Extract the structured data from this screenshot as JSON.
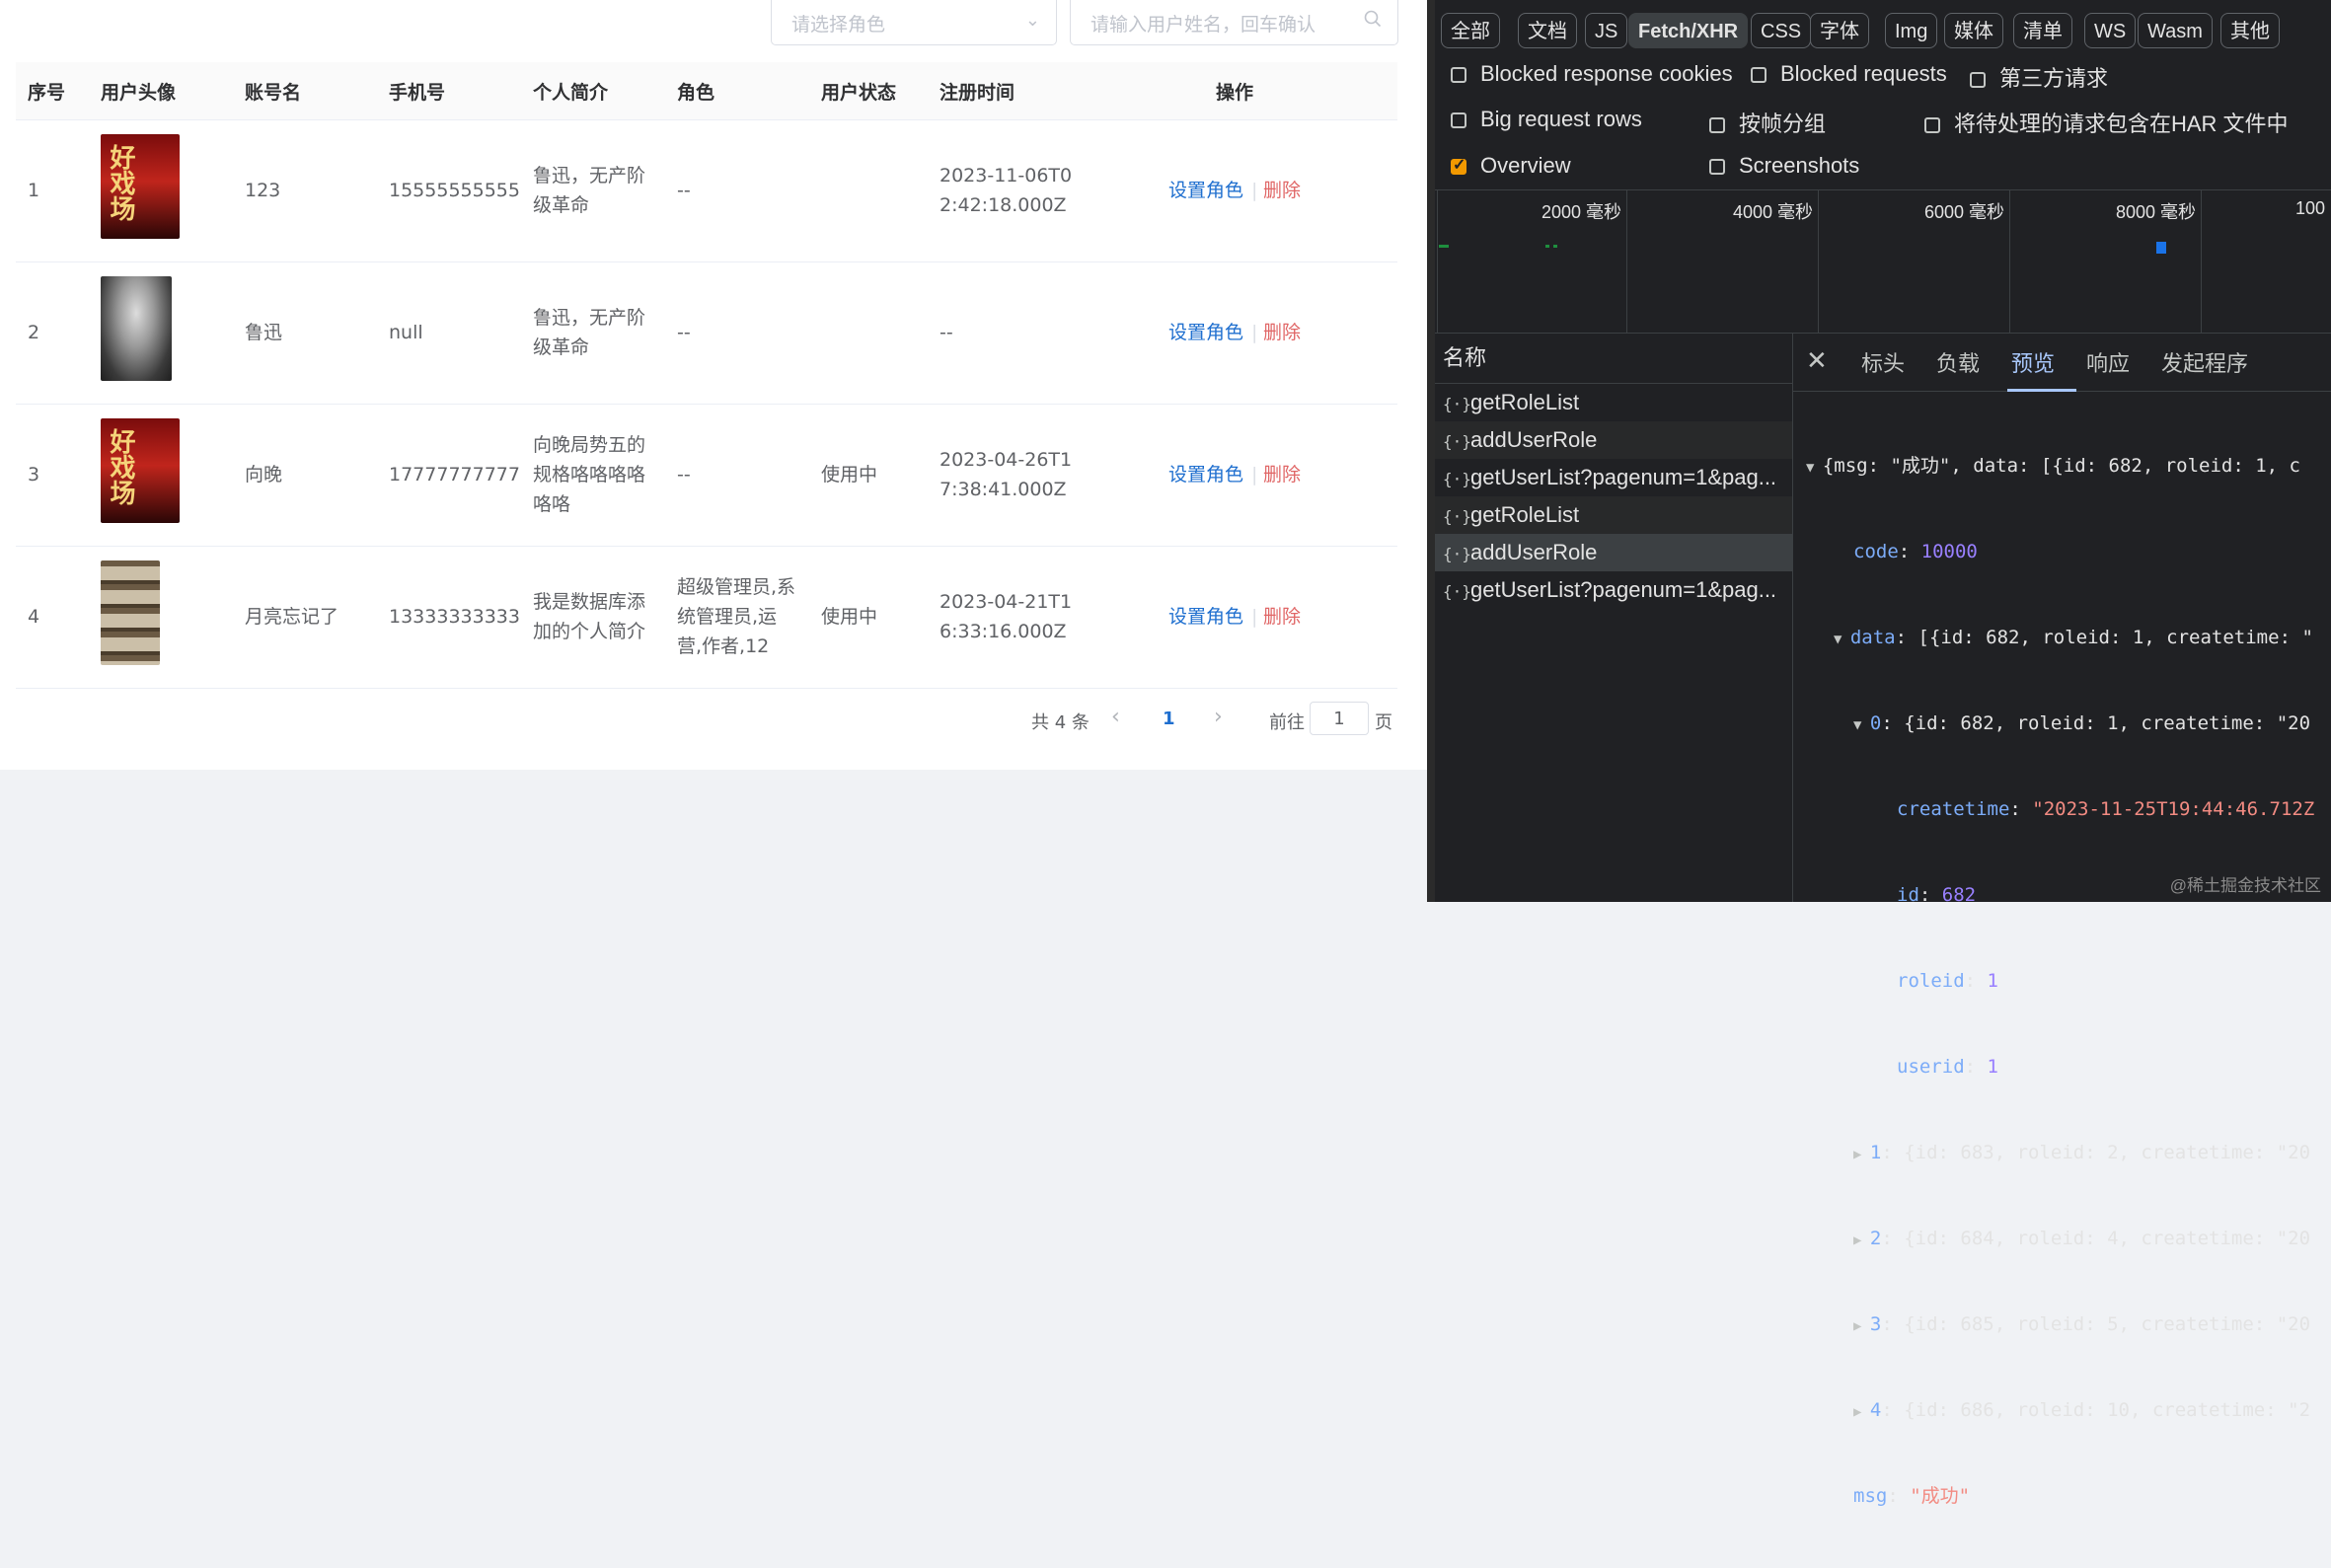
{
  "filters": {
    "role_placeholder": "请选择角色",
    "user_placeholder": "请输入用户姓名，回车确认"
  },
  "table": {
    "headers": [
      "序号",
      "用户头像",
      "账号名",
      "手机号",
      "个人简介",
      "角色",
      "用户状态",
      "注册时间",
      "操作"
    ],
    "rows": [
      {
        "index": "1",
        "name": "123",
        "phone": "15555555555",
        "bio_l1": "鲁迅，无产阶",
        "bio_l2": "级革命",
        "bio_l3": "",
        "role_l1": "--",
        "role_l2": "",
        "role_l3": "",
        "status": "",
        "time_l1": "2023-11-06T0",
        "time_l2": "2:42:18.000Z",
        "avatar": "poster",
        "poster_text": "好戏场"
      },
      {
        "index": "2",
        "name": "鲁迅",
        "phone": "null",
        "bio_l1": "鲁迅，无产阶",
        "bio_l2": "级革命",
        "bio_l3": "",
        "role_l1": "--",
        "role_l2": "",
        "role_l3": "",
        "status": "",
        "time_l1": "--",
        "time_l2": "",
        "avatar": "photo",
        "poster_text": ""
      },
      {
        "index": "3",
        "name": "向晚",
        "phone": "17777777777",
        "bio_l1": "向晚局势五的",
        "bio_l2": "规格咯咯咯咯",
        "bio_l3": "咯咯",
        "role_l1": "--",
        "role_l2": "",
        "role_l3": "",
        "status": "使用中",
        "time_l1": "2023-04-26T1",
        "time_l2": "7:38:41.000Z",
        "avatar": "poster",
        "poster_text": "好戏场"
      },
      {
        "index": "4",
        "name": "月亮忘记了",
        "phone": "13333333333",
        "bio_l1": "我是数据库添",
        "bio_l2": "加的个人简介",
        "bio_l3": "",
        "role_l1": "超级管理员,系",
        "role_l2": "统管理员,运",
        "role_l3": "营,作者,12",
        "status": "使用中",
        "time_l1": "2023-04-21T1",
        "time_l2": "6:33:16.000Z",
        "avatar": "shelf",
        "poster_text": ""
      }
    ],
    "action_set_role": "设置角色",
    "action_separator": "|",
    "action_delete": "删除"
  },
  "pagination": {
    "total": "共 4 条",
    "prev": "‹",
    "current": "1",
    "next": "›",
    "goto_prefix": "前往",
    "goto_value": "1",
    "goto_suffix": "页"
  },
  "devtools": {
    "filter_buttons": [
      "全部",
      "文档",
      "JS",
      "Fetch/XHR",
      "CSS",
      "字体",
      "Img",
      "媒体",
      "清单",
      "WS",
      "Wasm",
      "其他"
    ],
    "active_filter": "Fetch/XHR",
    "checkboxes": {
      "blocked_cookies": "Blocked response cookies",
      "blocked_requests": "Blocked requests",
      "third_party": "第三方请求",
      "big_rows": "Big request rows",
      "group_by_frame": "按帧分组",
      "har": "将待处理的请求包含在HAR 文件中",
      "overview": "Overview",
      "screenshots": "Screenshots"
    },
    "overview_checked": true,
    "timeline_ticks": [
      "2000  毫秒",
      "4000  毫秒",
      "6000  毫秒",
      "8000  毫秒",
      "100"
    ],
    "names_header": "名称",
    "requests": [
      "getRoleList",
      "addUserRole",
      "getUserList?pagenum=1&pag...",
      "getRoleList",
      "addUserRole",
      "getUserList?pagenum=1&pag..."
    ],
    "detail_tabs": [
      "标头",
      "负载",
      "预览",
      "响应",
      "发起程序"
    ],
    "active_tab": "预览",
    "preview": {
      "line0": "{msg: \"成功\", data: [{id: 682, roleid: 1, c",
      "code_key": "code",
      "code_val": "10000",
      "data_key": "data",
      "data_summary": "[{id: 682, roleid: 1, createtime: \"",
      "item0_key": "0",
      "item0_summary": "{id: 682, roleid: 1, createtime: \"20",
      "createtime_key": "createtime",
      "createtime_val": "\"2023-11-25T19:44:46.712Z",
      "id_key": "id",
      "id_val": "682",
      "roleid_key": "roleid",
      "roleid_val": "1",
      "userid_key": "userid",
      "userid_val": "1",
      "item1": "{id: 683, roleid: 2, createtime: \"20",
      "item2": "{id: 684, roleid: 4, createtime: \"20",
      "item3": "{id: 685, roleid: 5, createtime: \"20",
      "item4": "{id: 686, roleid: 10, createtime: \"2",
      "msg_key": "msg",
      "msg_val": "\"成功\""
    },
    "watermark": "@稀土掘金技术社区"
  }
}
